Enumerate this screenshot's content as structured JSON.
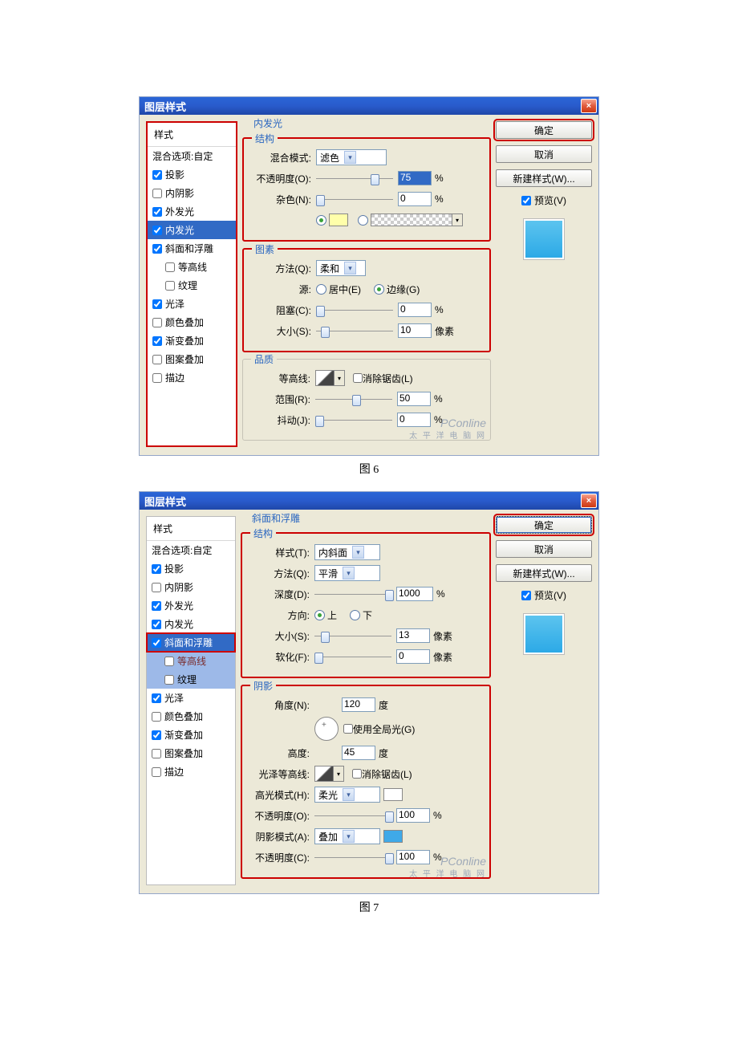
{
  "captions": {
    "fig6": "图 6",
    "fig7": "图 7"
  },
  "dialog_title": "图层样式",
  "buttons": {
    "ok": "确定",
    "cancel": "取消",
    "newstyle": "新建样式(W)...",
    "preview": "预览(V)"
  },
  "watermark": {
    "line1": "PConline",
    "line2": "太 平 洋 电 脑 网"
  },
  "sidebar_header": "样式",
  "styles": {
    "blend": "混合选项:自定",
    "drop": "投影",
    "inner_shadow": "内阴影",
    "outer_glow": "外发光",
    "inner_glow": "内发光",
    "bevel": "斜面和浮雕",
    "contour_sub": "等高线",
    "texture_sub": "纹理",
    "satin": "光泽",
    "color_overlay": "颜色叠加",
    "gradient_overlay": "渐变叠加",
    "pattern_overlay": "图案叠加",
    "stroke": "描边"
  },
  "fig6": {
    "title_section": "内发光",
    "groups": {
      "structure": "结构",
      "elements": "图素",
      "quality": "品质"
    },
    "labels": {
      "blend_mode": "混合模式:",
      "opacity": "不透明度(O):",
      "noise": "杂色(N):",
      "technique": "方法(Q):",
      "source": "源:",
      "center": "居中(E)",
      "edge": "边缘(G)",
      "choke": "阻塞(C):",
      "size": "大小(S):",
      "contour": "等高线:",
      "antialias": "消除锯齿(L)",
      "range": "范围(R):",
      "jitter": "抖动(J):"
    },
    "values": {
      "blend_mode": "滤色",
      "opacity": "75",
      "noise": "0",
      "technique": "柔和",
      "choke": "0",
      "size": "10",
      "range": "50",
      "jitter": "0"
    },
    "units": {
      "pct": "%",
      "px": "像素"
    },
    "checked": {
      "drop": true,
      "inner_shadow": false,
      "outer_glow": true,
      "inner_glow": true,
      "bevel": true,
      "contour_sub": false,
      "texture_sub": false,
      "satin": true,
      "color_overlay": false,
      "gradient_overlay": true,
      "pattern_overlay": false,
      "stroke": false
    }
  },
  "fig7": {
    "title_section": "斜面和浮雕",
    "groups": {
      "structure": "结构",
      "shading": "阴影"
    },
    "labels": {
      "style": "样式(T):",
      "technique": "方法(Q):",
      "depth": "深度(D):",
      "direction": "方向:",
      "up": "上",
      "down": "下",
      "size": "大小(S):",
      "soften": "软化(F):",
      "angle": "角度(N):",
      "deg": "度",
      "use_global": "使用全局光(G)",
      "altitude": "高度:",
      "gloss_contour": "光泽等高线:",
      "antialias": "消除锯齿(L)",
      "hl_mode": "高光模式(H):",
      "hl_opacity": "不透明度(O):",
      "sh_mode": "阴影模式(A):",
      "sh_opacity": "不透明度(C):"
    },
    "values": {
      "style": "内斜面",
      "technique": "平滑",
      "depth": "1000",
      "size": "13",
      "soften": "0",
      "angle": "120",
      "altitude": "45",
      "hl_mode": "柔光",
      "hl_opacity": "100",
      "sh_mode": "叠加",
      "sh_opacity": "100"
    },
    "units": {
      "pct": "%",
      "px": "像素"
    },
    "checked": {
      "drop": true,
      "inner_shadow": false,
      "outer_glow": true,
      "inner_glow": true,
      "bevel": true,
      "contour_sub": false,
      "texture_sub": false,
      "satin": true,
      "color_overlay": false,
      "gradient_overlay": true,
      "pattern_overlay": false,
      "stroke": false
    }
  }
}
